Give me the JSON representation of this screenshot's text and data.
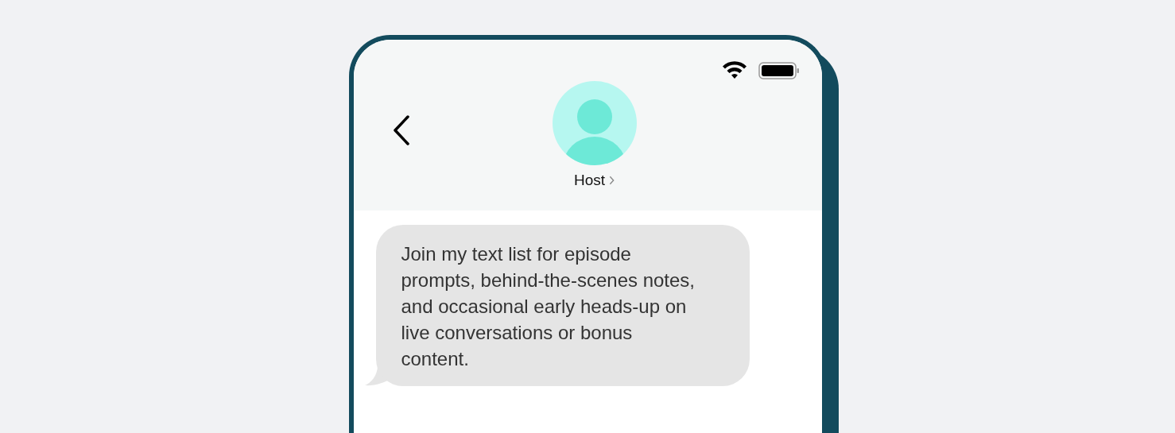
{
  "contact": {
    "name": "Host"
  },
  "messages": [
    {
      "text": "Join my text list for episode prompts, behind-the-scenes notes, and occasional early heads-up on live conversations or bonus content."
    }
  ]
}
